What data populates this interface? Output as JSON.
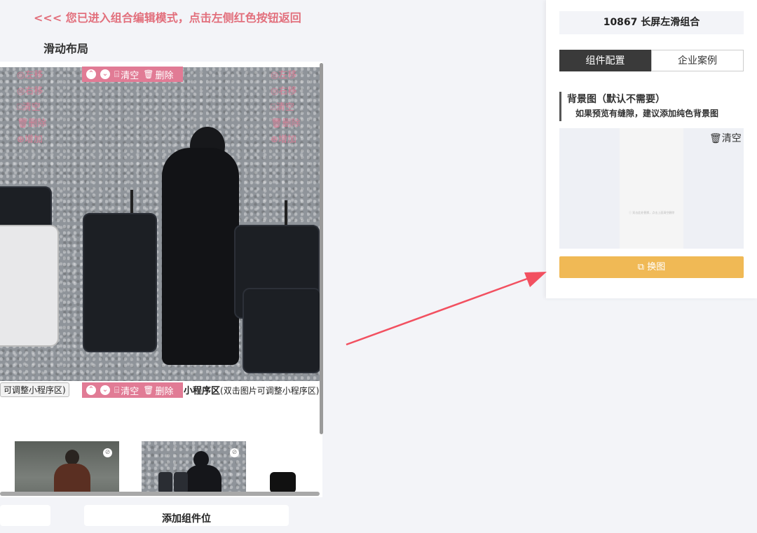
{
  "banner": "<<< 您已进入组合编辑模式，点击左侧红色按钮返回",
  "layout_title": "滑动布局",
  "toolbar": {
    "clear": "清空",
    "delete": "删除"
  },
  "side_controls": {
    "left": [
      "左移",
      "右移",
      "清空",
      "删除",
      "增加"
    ],
    "right": [
      "左移",
      "右移",
      "清空",
      "删除",
      "增加"
    ]
  },
  "captions": {
    "left": "可调整小程序区)",
    "right_bold": "小程序区",
    "right_normal": "(双击图片可调整小程序区)"
  },
  "bottom": {
    "add_component": "添加组件位"
  },
  "panel": {
    "header": "10867 长屏左滑组合",
    "tab_config": "组件配置",
    "tab_cases": "企业案例",
    "bg_title": "背景图（默认不需要）",
    "bg_hint": "如果预览有缝隙，建议添加纯色背景图",
    "bg_tiny_text": "ⓘ 双击此处替换，点击上面清空删除",
    "bg_clear": "清空",
    "swap_button": "换图"
  },
  "colors": {
    "accent_pink": "#e17b95",
    "banner_pink": "#e26f7c",
    "swap_orange": "#f0b955",
    "arrow_red": "#f25060",
    "tab_active": "#3a3a3a"
  },
  "icons": {
    "move_top": "double-chevron-up-icon",
    "move_down": "chevron-down-circle-icon",
    "clear": "eraser-icon",
    "delete": "trash-icon",
    "link": "link-icon",
    "swap": "image-swap-icon"
  }
}
